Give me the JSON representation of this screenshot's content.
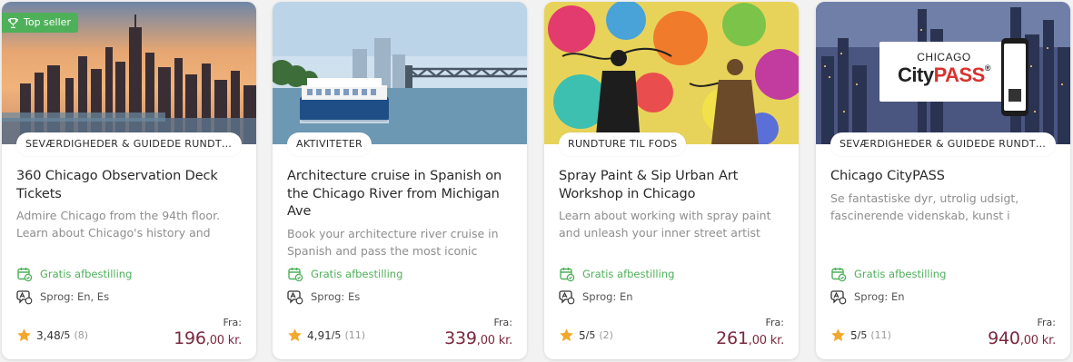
{
  "cards": [
    {
      "badge": "Top seller",
      "category": "SEVÆRDIGHEDER & GUIDEDE RUNDTURE",
      "title": "360 Chicago Observation Deck Tickets",
      "description": "Admire Chicago from the 94th floor. Learn about Chicago's history and",
      "cancellation": "Gratis afbestilling",
      "language": "Sprog: En, Es",
      "rating": "3,48",
      "rating_max": "/5",
      "reviews": "(8)",
      "from_label": "Fra:",
      "price_main": "196",
      "price_dec": ",00 kr."
    },
    {
      "category": "AKTIVITETER",
      "title": "Architecture cruise in Spanish on the Chicago River from Michigan Ave",
      "description": "Book your architecture river cruise in Spanish and pass the most iconic building",
      "cancellation": "Gratis afbestilling",
      "language": "Sprog: Es",
      "rating": "4,91",
      "rating_max": "/5",
      "reviews": "(11)",
      "from_label": "Fra:",
      "price_main": "339",
      "price_dec": ",00 kr."
    },
    {
      "category": "RUNDTURE TIL FODS",
      "title": "Spray Paint & Sip Urban Art Workshop in Chicago",
      "description": "Learn about working with spray paint and unleash your inner street artist during",
      "cancellation": "Gratis afbestilling",
      "language": "Sprog: En",
      "rating": "5",
      "rating_max": "/5",
      "reviews": "(2)",
      "from_label": "Fra:",
      "price_main": "261",
      "price_dec": ",00 kr."
    },
    {
      "category": "SEVÆRDIGHEDER & GUIDEDE RUNDTURE",
      "title": "Chicago CityPASS",
      "description": "Se fantastiske dyr, utrolig udsigt, fascinerende videnskab, kunst i",
      "cancellation": "Gratis afbestilling",
      "language": "Sprog: En",
      "rating": "5",
      "rating_max": "/5",
      "reviews": "(11)",
      "from_label": "Fra:",
      "price_main": "940",
      "price_dec": ",00 kr.",
      "image_text": {
        "top": "CHICAGO",
        "brand_a": "City",
        "brand_b": "PASS",
        "reg": "®"
      }
    }
  ],
  "colors": {
    "green": "#4fb05a",
    "price": "#7a2840",
    "star": "#f2a82b",
    "muted": "#8e8e8e"
  },
  "icons": {
    "badge": "trophy-icon",
    "cancel": "calendar-check-icon",
    "language": "speech-globe-icon",
    "rating": "star-icon"
  }
}
